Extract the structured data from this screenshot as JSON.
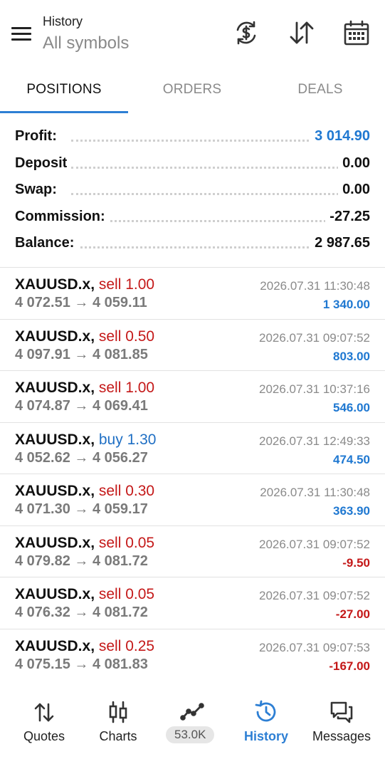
{
  "header": {
    "title": "History",
    "subtitle": "All symbols",
    "icons": [
      "currency-exchange-icon",
      "sort-icon",
      "calendar-icon"
    ]
  },
  "tabs": [
    {
      "label": "POSITIONS",
      "active": true
    },
    {
      "label": "ORDERS",
      "active": false
    },
    {
      "label": "DEALS",
      "active": false
    }
  ],
  "summary": [
    {
      "label": "Profit:",
      "value": "3 014.90",
      "highlight": true
    },
    {
      "label": "Deposit",
      "value": "0.00",
      "highlight": false
    },
    {
      "label": "Swap:",
      "value": "0.00",
      "highlight": false
    },
    {
      "label": "Commission:",
      "value": "-27.25",
      "highlight": false
    },
    {
      "label": "Balance:",
      "value": "2 987.65",
      "highlight": false
    }
  ],
  "deals": [
    {
      "symbol": "XAUUSD.x,",
      "side": "sell 1.00",
      "type": "sell",
      "open": "4 072.51",
      "arrow": "→",
      "close": "4 059.11",
      "time": "2026.07.31 11:30:48",
      "profit": "1 340.00",
      "positive": true
    },
    {
      "symbol": "XAUUSD.x,",
      "side": "sell 0.50",
      "type": "sell",
      "open": "4 097.91",
      "arrow": "→",
      "close": "4 081.85",
      "time": "2026.07.31 09:07:52",
      "profit": "803.00",
      "positive": true
    },
    {
      "symbol": "XAUUSD.x,",
      "side": "sell 1.00",
      "type": "sell",
      "open": "4 074.87",
      "arrow": "→",
      "close": "4 069.41",
      "time": "2026.07.31 10:37:16",
      "profit": "546.00",
      "positive": true
    },
    {
      "symbol": "XAUUSD.x,",
      "side": "buy 1.30",
      "type": "buy",
      "open": "4 052.62",
      "arrow": "→",
      "close": "4 056.27",
      "time": "2026.07.31 12:49:33",
      "profit": "474.50",
      "positive": true
    },
    {
      "symbol": "XAUUSD.x,",
      "side": "sell 0.30",
      "type": "sell",
      "open": "4 071.30",
      "arrow": "→",
      "close": "4 059.17",
      "time": "2026.07.31 11:30:48",
      "profit": "363.90",
      "positive": true
    },
    {
      "symbol": "XAUUSD.x,",
      "side": "sell 0.05",
      "type": "sell",
      "open": "4 079.82",
      "arrow": "→",
      "close": "4 081.72",
      "time": "2026.07.31 09:07:52",
      "profit": "-9.50",
      "positive": false
    },
    {
      "symbol": "XAUUSD.x,",
      "side": "sell 0.05",
      "type": "sell",
      "open": "4 076.32",
      "arrow": "→",
      "close": "4 081.72",
      "time": "2026.07.31 09:07:52",
      "profit": "-27.00",
      "positive": false
    },
    {
      "symbol": "XAUUSD.x,",
      "side": "sell 0.25",
      "type": "sell",
      "open": "4 075.15",
      "arrow": "→",
      "close": "4 081.83",
      "time": "2026.07.31 09:07:53",
      "profit": "-167.00",
      "positive": false
    }
  ],
  "nav": [
    {
      "label": "Quotes",
      "icon": "quotes-icon",
      "active": false
    },
    {
      "label": "Charts",
      "icon": "candlestick-chart-icon",
      "active": false
    },
    {
      "label": "",
      "icon": "trade-line-icon",
      "active": false,
      "badge": "53.0K"
    },
    {
      "label": "History",
      "icon": "history-icon",
      "active": true
    },
    {
      "label": "Messages",
      "icon": "messages-icon",
      "active": false
    }
  ],
  "colors": {
    "accent": "#2d7fd4",
    "profit": "#1f78d1",
    "loss": "#c41818",
    "sell": "#c41818",
    "buy": "#1f6fc4"
  }
}
